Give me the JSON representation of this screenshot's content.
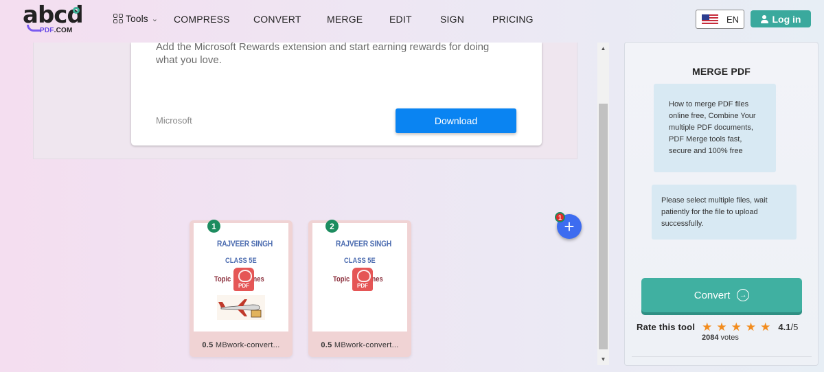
{
  "header": {
    "logo_word": "abcd",
    "logo_sub_prefix": "PDF",
    "logo_sub_suffix": ".COM",
    "tools_label": "Tools",
    "nav": [
      "COMPRESS",
      "CONVERT",
      "MERGE",
      "EDIT",
      "SIGN",
      "PRICING"
    ],
    "language": "EN",
    "login_label": "Log in"
  },
  "ad": {
    "text": "Add the Microsoft Rewards extension and start earning rewards for doing what you love.",
    "brand": "Microsoft",
    "button_label": "Download"
  },
  "files": [
    {
      "index": "1",
      "size": "0.5",
      "size_unit": " MBwork-convert...",
      "doc_line1": "RAJVEER SINGH",
      "doc_line2": "CLASS 5E",
      "doc_line3": "Topic",
      "doc_line3_tail": "nes",
      "pdf_label": "PDF"
    },
    {
      "index": "2",
      "size": "0.5",
      "size_unit": " MBwork-convert...",
      "doc_line1": "RAJVEER SINGH",
      "doc_line2": "CLASS 5E",
      "doc_line3": "Topic",
      "doc_line3_tail": "nes",
      "pdf_label": "PDF"
    }
  ],
  "add_button": {
    "count": "1",
    "icon": "plus-icon"
  },
  "sidebar": {
    "title": "MERGE PDF",
    "info_text": "How to merge PDF files online free, Combine Your multiple PDF documents, PDF Merge tools fast, secure and 100% free",
    "hint_text": "Please select multiple files, wait patiently for the file to upload successfully.",
    "convert_label": "Convert",
    "rate_label": "Rate this tool",
    "rating": 4.1,
    "rating_value": "4.1",
    "rating_max": "/5",
    "stars": 5,
    "votes_count": "2084",
    "votes_label": " votes"
  },
  "colors": {
    "accent": "#40b0a1",
    "login": "#3aa99d",
    "ad_button": "#0a84f2",
    "add_button": "#3d6cf0",
    "star": "#f28c1e",
    "badge": "#1d8c5f"
  }
}
